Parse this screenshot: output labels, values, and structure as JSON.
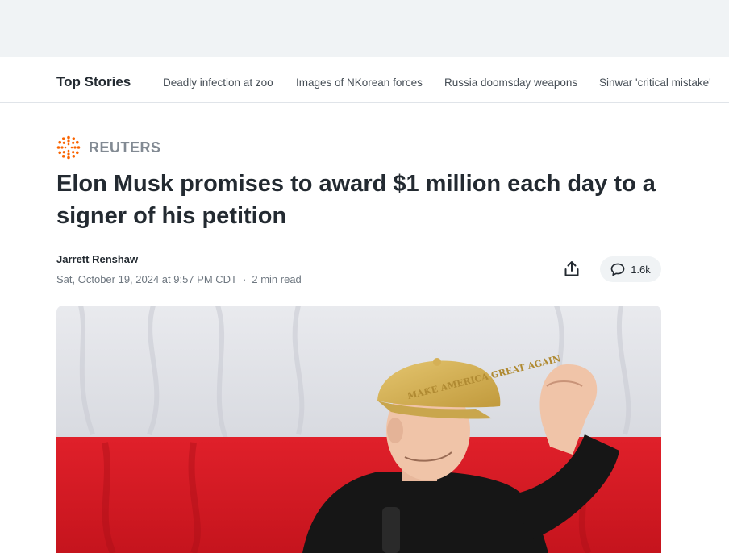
{
  "top_stories": {
    "title": "Top Stories",
    "links": [
      "Deadly infection at zoo",
      "Images of NKorean forces",
      "Russia doomsday weapons",
      "Sinwar 'critical mistake'"
    ]
  },
  "article": {
    "publisher": "REUTERS",
    "headline": "Elon Musk promises to award $1 million each day to a signer of his petition",
    "author": "Jarrett Renshaw",
    "date": "Sat, October 19, 2024 at 9:57 PM CDT",
    "read_time": "2 min read",
    "comment_count": "1.6k",
    "hat_text": "MAKE AMERICA GREAT AGAIN"
  },
  "icons": {
    "publisher_logo": "reuters-logo-icon",
    "share": "share-icon",
    "comment": "comment-icon"
  },
  "colors": {
    "reuters_orange": "#fa6400",
    "text_dark": "#232a31",
    "text_muted": "#6e7780",
    "flag_red": "#d71a22"
  }
}
